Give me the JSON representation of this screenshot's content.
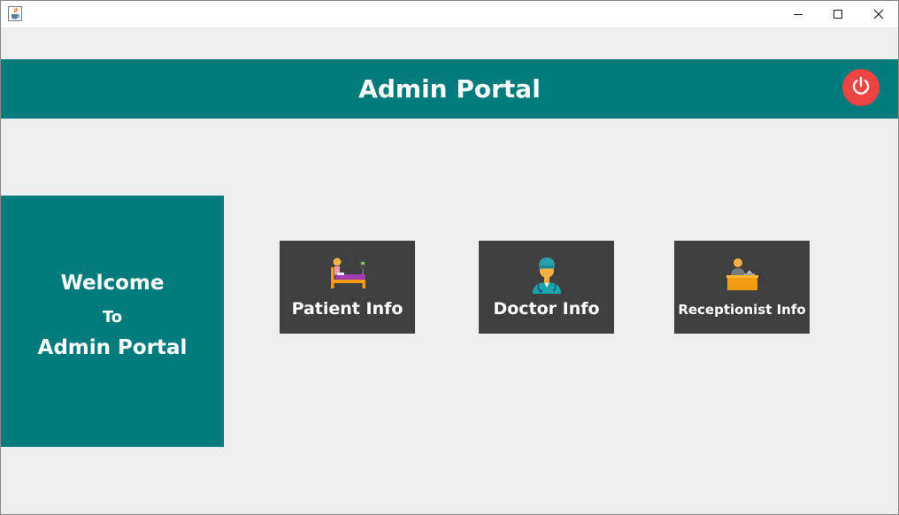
{
  "window": {
    "app_icon": "java-cup-icon",
    "controls": [
      "minimize-icon",
      "maximize-icon",
      "close-icon"
    ]
  },
  "header": {
    "title": "Admin Portal",
    "logout_icon": "power-icon"
  },
  "welcome": {
    "line1": "Welcome",
    "line2": "To",
    "line3": "Admin Portal"
  },
  "tiles": [
    {
      "label": "Patient Info",
      "icon": "patient-bed-icon"
    },
    {
      "label": "Doctor Info",
      "icon": "doctor-icon"
    },
    {
      "label": "Receptionist Info",
      "icon": "receptionist-icon"
    }
  ],
  "colors": {
    "accent": "#017b7b",
    "tile_bg": "#3f3f3f",
    "power_button": "#ef4444",
    "background": "#eeeeee"
  }
}
